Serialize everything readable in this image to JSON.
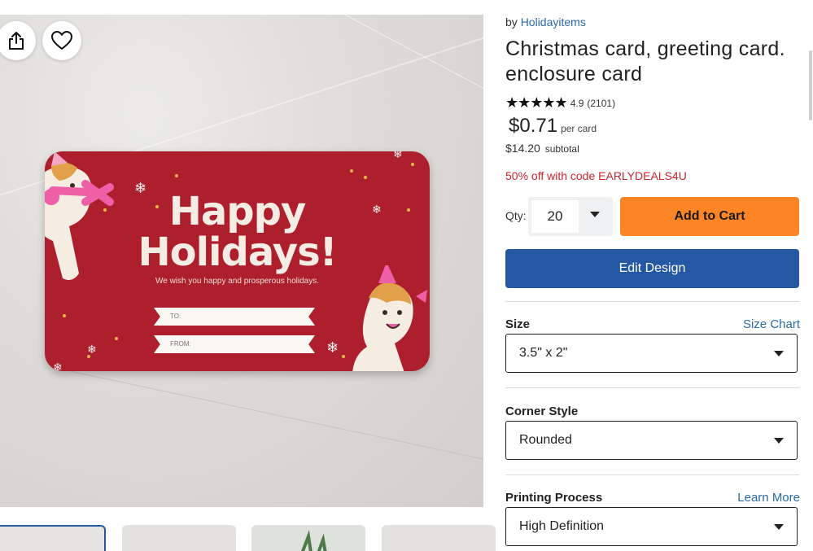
{
  "product": {
    "by_prefix": "by",
    "seller": "Holidayitems",
    "title": "Christmas card, greeting card. enclosure card",
    "rating": {
      "stars": "★★★★★",
      "value": "4.9",
      "count": "(2101)"
    },
    "price": "$0.71",
    "price_unit": "per card",
    "subtotal": "$14.20",
    "subtotal_label": "subtotal",
    "promo": "50% off with code EARLYDEALS4U"
  },
  "purchase": {
    "qty_label": "Qty:",
    "qty_value": "20",
    "add_to_cart": "Add to Cart",
    "edit_design": "Edit Design"
  },
  "options": {
    "size": {
      "label": "Size",
      "link": "Size Chart",
      "value": "3.5\" x 2\""
    },
    "corner": {
      "label": "Corner Style",
      "value": "Rounded"
    },
    "printing": {
      "label": "Printing Process",
      "link": "Learn More",
      "value": "High Definition"
    }
  },
  "card_art": {
    "line1": "Happy",
    "line2": "Holidays!",
    "subtitle": "We wish you happy and prosperous holidays.",
    "to_label": "TO:",
    "from_label": "FROM:"
  },
  "colors": {
    "accent_orange": "#fd8526",
    "primary_blue": "#2558a3",
    "link_blue": "#2a6aa8",
    "promo_red": "#c8262f",
    "card_red": "#ad1f2c"
  },
  "icons": [
    "share-icon",
    "heart-icon",
    "chevron-down-icon"
  ]
}
